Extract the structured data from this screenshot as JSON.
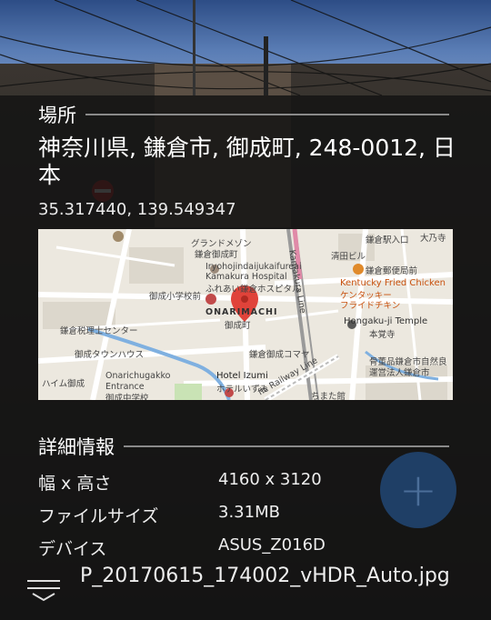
{
  "location": {
    "section_title": "場所",
    "address": "神奈川県, 鎌倉市, 御成町, 248-0012, 日本",
    "coordinates": "35.317440, 139.549347"
  },
  "map": {
    "labels": [
      "グランドメゾン",
      "鎌倉御成町",
      "Iryohojindaijukaifureai",
      "Kamakura Hospital",
      "ふれあい鎌倉ホスピタル",
      "御成小学校前",
      "ONARIMACHI",
      "御成町",
      "鎌倉税理士センター",
      "御成タウンハウス",
      "ハイム御成",
      "Onarichugakko",
      "Entrance",
      "御成中学校",
      "Hotel Izumi",
      "ホテルいずみ",
      "鎌倉御成コマヤ",
      "Kamakura Line",
      "清田ビル",
      "鎌倉駅入口",
      "鎌倉郵便局前",
      "Kentucky Fried Chicken",
      "ケンタッキー",
      "フライドチキン",
      "Hongaku-ji Temple",
      "本覚寺",
      "骨董品鎌倉市自然良",
      "運営法人鎌倉市",
      "大乃寺",
      "ちまた館",
      "fic Railway Line"
    ]
  },
  "details": {
    "section_title": "詳細情報",
    "rows": [
      {
        "key": "幅 x 高さ",
        "value": "4160 x 3120"
      },
      {
        "key": "ファイルサイズ",
        "value": "3.31MB"
      },
      {
        "key": "デバイス",
        "value": "ASUS_Z016D"
      }
    ]
  },
  "fab": {
    "icon": "plus-icon",
    "color": "#1f3f66"
  },
  "footer": {
    "filename": "P_20170615_174002_vHDR_Auto.jpg",
    "menu_icon": "menu-expand-icon"
  }
}
